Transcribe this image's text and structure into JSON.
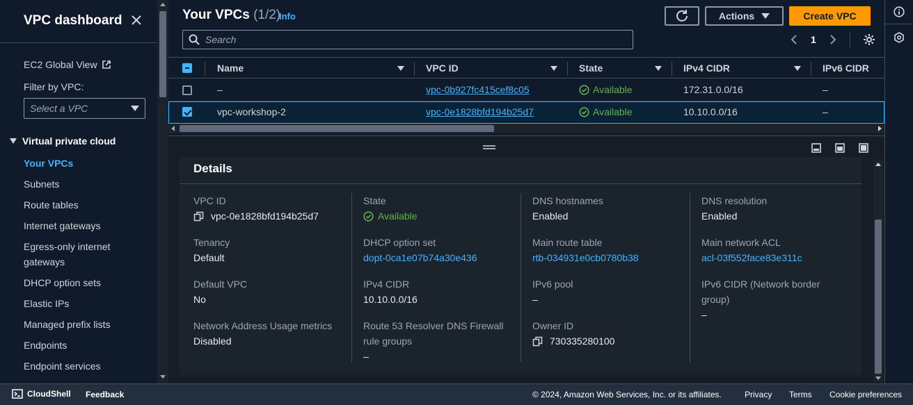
{
  "sidebar": {
    "title": "VPC dashboard",
    "global_view": "EC2 Global View",
    "filter_label": "Filter by VPC:",
    "filter_placeholder": "Select a VPC",
    "section": "Virtual private cloud",
    "items": [
      {
        "label": "Your VPCs",
        "active": true
      },
      {
        "label": "Subnets"
      },
      {
        "label": "Route tables"
      },
      {
        "label": "Internet gateways"
      },
      {
        "label": "Egress-only internet gateways"
      },
      {
        "label": "DHCP option sets"
      },
      {
        "label": "Elastic IPs"
      },
      {
        "label": "Managed prefix lists"
      },
      {
        "label": "Endpoints"
      },
      {
        "label": "Endpoint services"
      }
    ]
  },
  "header": {
    "title": "Your VPCs",
    "count": "(1/2)",
    "info": "Info",
    "actions": "Actions",
    "create": "Create VPC",
    "search_placeholder": "Search",
    "page": "1"
  },
  "table": {
    "columns": [
      "Name",
      "VPC ID",
      "State",
      "IPv4 CIDR",
      "IPv6 CIDR"
    ],
    "rows": [
      {
        "selected": false,
        "name": "–",
        "vpc_id": "vpc-0b927fc415cef8c05",
        "state": "Available",
        "ipv4": "172.31.0.0/16",
        "ipv6": "–"
      },
      {
        "selected": true,
        "name": "vpc-workshop-2",
        "vpc_id": "vpc-0e1828bfd194b25d7",
        "state": "Available",
        "ipv4": "10.10.0.0/16",
        "ipv6": "–"
      }
    ]
  },
  "details": {
    "title": "Details",
    "col1": [
      {
        "k": "VPC ID",
        "v": "vpc-0e1828bfd194b25d7"
      },
      {
        "k": "Tenancy",
        "v": "Default"
      },
      {
        "k": "Default VPC",
        "v": "No"
      },
      {
        "k": "Network Address Usage metrics",
        "v": "Disabled"
      }
    ],
    "col2": [
      {
        "k": "State",
        "v": "Available"
      },
      {
        "k": "DHCP option set",
        "v": "dopt-0ca1e07b74a30e436"
      },
      {
        "k": "IPv4 CIDR",
        "v": "10.10.0.0/16"
      },
      {
        "k": "Route 53 Resolver DNS Firewall rule groups",
        "v": "–"
      }
    ],
    "col3": [
      {
        "k": "DNS hostnames",
        "v": "Enabled"
      },
      {
        "k": "Main route table",
        "v": "rtb-034931e0cb0780b38"
      },
      {
        "k": "IPv6 pool",
        "v": "–"
      },
      {
        "k": "Owner ID",
        "v": "730335280100"
      }
    ],
    "col4": [
      {
        "k": "DNS resolution",
        "v": "Enabled"
      },
      {
        "k": "Main network ACL",
        "v": "acl-03f552face83e311c"
      },
      {
        "k": "IPv6 CIDR (Network border group)",
        "v": "–"
      }
    ]
  },
  "footer": {
    "cloudshell": "CloudShell",
    "feedback": "Feedback",
    "copyright": "© 2024, Amazon Web Services, Inc. or its affiliates.",
    "privacy": "Privacy",
    "terms": "Terms",
    "cookies": "Cookie preferences"
  },
  "colors": {
    "accent": "#42b4ff",
    "primary": "#ff9900",
    "success": "#5fb547"
  }
}
